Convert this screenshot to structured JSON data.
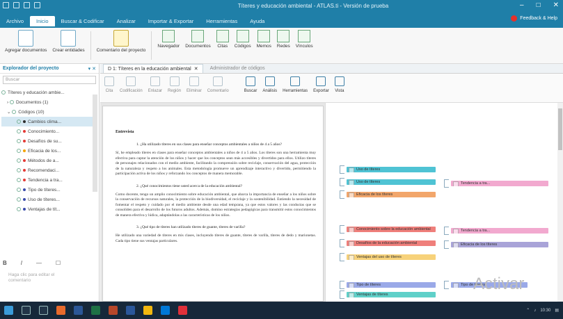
{
  "titlebar": {
    "title": "Títeres y educación ambiental - ATLAS.ti - Versión de prueba",
    "tabs": [
      "Archivo",
      "Inicio",
      "Buscar & Codificar",
      "Analizar",
      "Importar & Exportar",
      "Herramientas",
      "Ayuda"
    ],
    "active_tab": "Inicio",
    "feedback": "Feedback & Help"
  },
  "ribbon": {
    "items": [
      {
        "label": "Agregar documentos"
      },
      {
        "label": "Crear entidades"
      },
      {
        "label": "Comentario del proyecto"
      },
      {
        "label": "Navegador"
      },
      {
        "label": "Documentos"
      },
      {
        "label": "Citas"
      },
      {
        "label": "Códigos"
      },
      {
        "label": "Memos"
      },
      {
        "label": "Redes"
      },
      {
        "label": "Vínculos"
      }
    ]
  },
  "leftpanel": {
    "title": "Explorador del proyecto",
    "search_placeholder": "Buscar",
    "project": "Títeres y educación ambie...",
    "documents": "Documentos (1)",
    "codes": "Códigos (10)",
    "code_items": [
      {
        "label": "Cambios clima...",
        "color": "#2c2c2c"
      },
      {
        "label": "Conocimiento...",
        "color": "#e53935"
      },
      {
        "label": "Desafíos de su...",
        "color": "#e53935"
      },
      {
        "label": "Eficacia de los...",
        "color": "#f4a300"
      },
      {
        "label": "Métodos de a...",
        "color": "#e53935"
      },
      {
        "label": "Recomendaci...",
        "color": "#e53935"
      },
      {
        "label": "Tendencia a tra...",
        "color": "#e53935"
      },
      {
        "label": "Tipo de títeres...",
        "color": "#3949ab"
      },
      {
        "label": "Uso de títeres...",
        "color": "#3949ab"
      },
      {
        "label": "Ventajas de tít...",
        "color": "#3949ab"
      }
    ],
    "hint": "Haga clic para editar el comentario"
  },
  "doctabs": {
    "active": "D 1: Títeres en la educación ambiental",
    "inactive": "Administrador de códigos"
  },
  "doctoolbar": {
    "buttons": [
      {
        "label": "Cita",
        "active": false
      },
      {
        "label": "Codificación",
        "active": false
      },
      {
        "label": "Enlazar",
        "active": false
      },
      {
        "label": "Región",
        "active": false
      },
      {
        "label": "Eliminar",
        "active": false
      },
      {
        "label": "Comentario",
        "active": false
      },
      {
        "label": "Buscar",
        "active": true
      },
      {
        "label": "Análisis",
        "active": true
      },
      {
        "label": "Herramientas",
        "active": true
      },
      {
        "label": "Exportar",
        "active": true
      },
      {
        "label": "Vista",
        "active": true
      }
    ]
  },
  "document": {
    "heading": "Entrevista",
    "q1": "1.  ¿Ha utilizado títeres en sus clases para enseñar conceptos ambientales a niños de 4 a 5 años?",
    "p1": "Sí, he empleado títeres en clases para enseñar conceptos ambientales a niños de 4 a 5 años. Los títeres son una herramienta muy efectiva para captar la atención de los niños y hacer que los conceptos sean más accesibles y divertidos para ellos. Utilizo títeres de personajes relacionados con el medio ambiente, facilitando la comprensión sobre reciclaje, conservación del agua, protección de la naturaleza y respeto a los animales. Esta metodología promueve un aprendizaje interactivo y divertido, permitiendo la participación activa de los niños y reforzando los conceptos de manera memorable.",
    "q2": "2.  ¿Qué conocimientos tiene usted acerca de la educación ambiental?",
    "p2": "Como docente, tengo un amplio conocimiento sobre educación ambiental, que abarca la importancia de enseñar a los niños sobre la conservación de recursos naturales, la protección de la biodiversidad, el reciclaje y la sostenibilidad. Entiendo la necesidad de fomentar el respeto y cuidado por el medio ambiente desde una edad temprana, ya que estos valores y las conductas que se consoliden para el desarrollo de los futuros adultos. Además, domino estrategias pedagógicas para transmitir estos conocimientos de manera efectiva y lúdica, adaptándolas a las características de los niños.",
    "q3": "3.  ¿Qué tipo de títeres han utilizado títeres de guante, títeres de varilla?",
    "p3": "He utilizado una variedad de títeres en mis clases, incluyendo títeres de guante, títeres de varilla, títeres de dedo y marionetas. Cada tipo tiene sus ventajas particulares."
  },
  "codes_margin": [
    {
      "label": "Uso de títeres",
      "color": "#4fc3d4"
    },
    {
      "label": "Uso de títeres",
      "color": "#4fc3d4"
    },
    {
      "label": "Eficacia de los títeres",
      "color": "#f2a66b"
    },
    {
      "label": "Tendencia a tra...",
      "color": "#f2a9cf"
    },
    {
      "label": "Conocimiento sobre la educación ambiental",
      "color": "#ef7f7b"
    },
    {
      "label": "Desafíos de la educación ambiental",
      "color": "#ef7f7b"
    },
    {
      "label": "Ventajas del uso de títeres",
      "color": "#f7d27a"
    },
    {
      "label": "Tendencia a tra...",
      "color": "#f2a9cf"
    },
    {
      "label": "Eficacia de los títeres",
      "color": "#a9a4d8"
    },
    {
      "label": "Tipo de títeres",
      "color": "#9aa9e8"
    },
    {
      "label": "Ventajas de títeres",
      "color": "#5fd0c9"
    },
    {
      "label": "Tipo de títeres",
      "color": "#9aa9e8"
    }
  ],
  "watermark": "Activar",
  "taskbar": {
    "time": "10:30"
  }
}
